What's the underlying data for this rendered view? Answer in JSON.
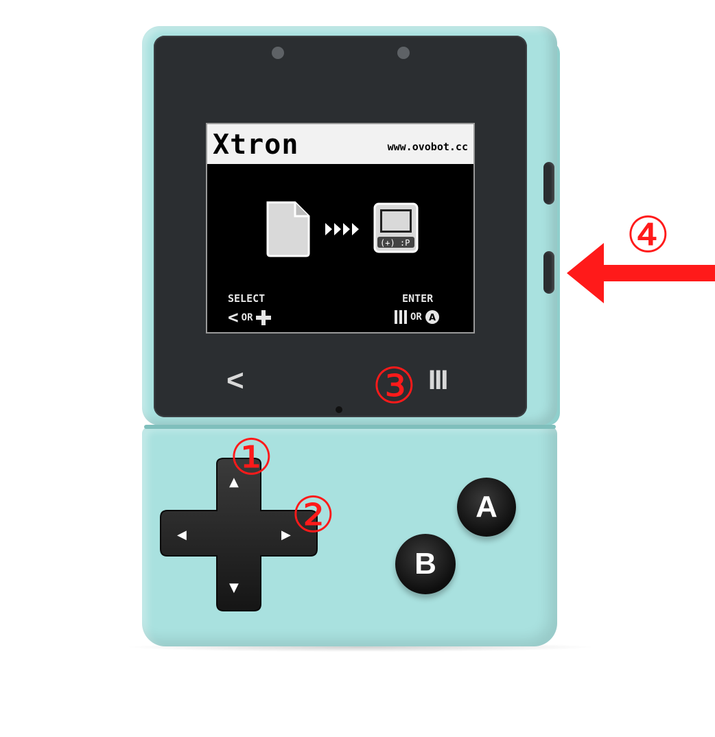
{
  "device": {
    "body_color": "#a9e1df",
    "screen": {
      "logo_text": "Xtron",
      "url_text": "www.ovobot.cc",
      "left_hint_title": "SELECT",
      "left_hint_sub": "OR",
      "right_hint_title": "ENTER",
      "right_hint_sub": "OR",
      "icons": [
        "file-icon",
        "arrows-icon",
        "console-icon"
      ]
    },
    "softkeys": {
      "back_label": "<",
      "menu_label": "III"
    },
    "buttons": {
      "a_label": "A",
      "b_label": "B"
    },
    "dpad": {
      "up": "▲",
      "down": "▼",
      "left": "◀",
      "right": "▶"
    }
  },
  "annotations": {
    "callout_1": "①",
    "callout_2": "②",
    "callout_3": "③",
    "callout_4": "④",
    "accent_color": "#ff1a1a"
  }
}
